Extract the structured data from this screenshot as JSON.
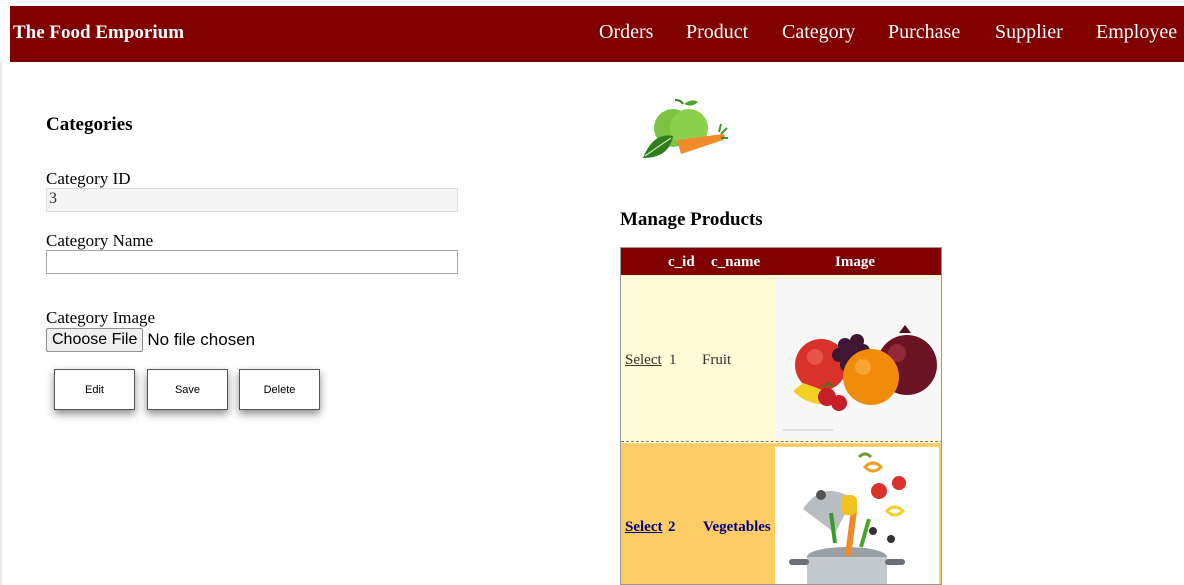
{
  "navbar": {
    "brand": "The Food Emporium",
    "links": [
      "Orders",
      "Product",
      "Category",
      "Purchase",
      "Supplier",
      "Employee"
    ]
  },
  "form": {
    "title": "Categories",
    "category_id": {
      "label": "Category ID",
      "value": "3"
    },
    "category_name": {
      "label": "Category Name",
      "value": ""
    },
    "category_image": {
      "label": "Category Image",
      "button": "Choose File",
      "status": "No file chosen"
    },
    "buttons": {
      "edit": "Edit",
      "save": "Save",
      "delete": "Delete"
    }
  },
  "grid": {
    "title": "Manage Products",
    "headers": [
      "c_id",
      "c_name",
      "Image"
    ],
    "rows": [
      {
        "select": "Select",
        "c_id": "1",
        "c_name": "Fruit",
        "image": "fruit-image"
      },
      {
        "select": "Select",
        "c_id": "2",
        "c_name": "Vegetables",
        "image": "vegetables-image"
      }
    ]
  },
  "colors": {
    "navbar": "#800000",
    "grid_header": "#800000",
    "row_light": "#fffbd6",
    "row_alt": "#ffcc66",
    "alt_text": "#000080"
  },
  "icons": {
    "logo": "apple-carrot-logo"
  }
}
